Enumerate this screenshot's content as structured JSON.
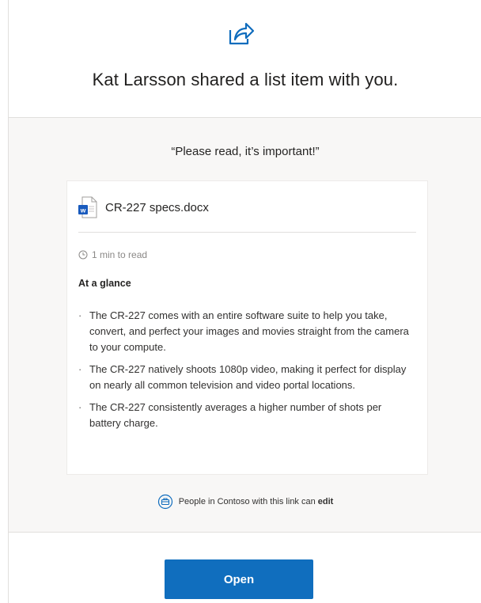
{
  "header": {
    "icon": "share-icon",
    "headline": "Kat Larsson shared a list item with you."
  },
  "message": "“Please read, it’s important!”",
  "card": {
    "file": {
      "icon": "word-document-icon",
      "icon_badge": "w",
      "name": "CR-227 specs.docx"
    },
    "read_time": "1 min to read",
    "section_title": "At a glance",
    "bullet_glyph": "·",
    "bullets": [
      "The CR-227 comes with an entire software suite to help you take, convert, and perfect your images and movies straight from the camera to your compute.",
      "The CR-227 natively shoots 1080p video, making it perfect for display on nearly all common television and video portal locations.",
      "The CR-227 consistently averages a higher number of shots per battery charge."
    ]
  },
  "permission": {
    "icon": "organization-link-icon",
    "text": "People in Contoso with this link can",
    "emphasis": "edit"
  },
  "actions": {
    "open_label": "Open"
  },
  "colors": {
    "accent": "#106ebe",
    "icon_blue": "#0f6cbd",
    "word_blue": "#185abd",
    "panel_bg": "#f8f7f6"
  }
}
